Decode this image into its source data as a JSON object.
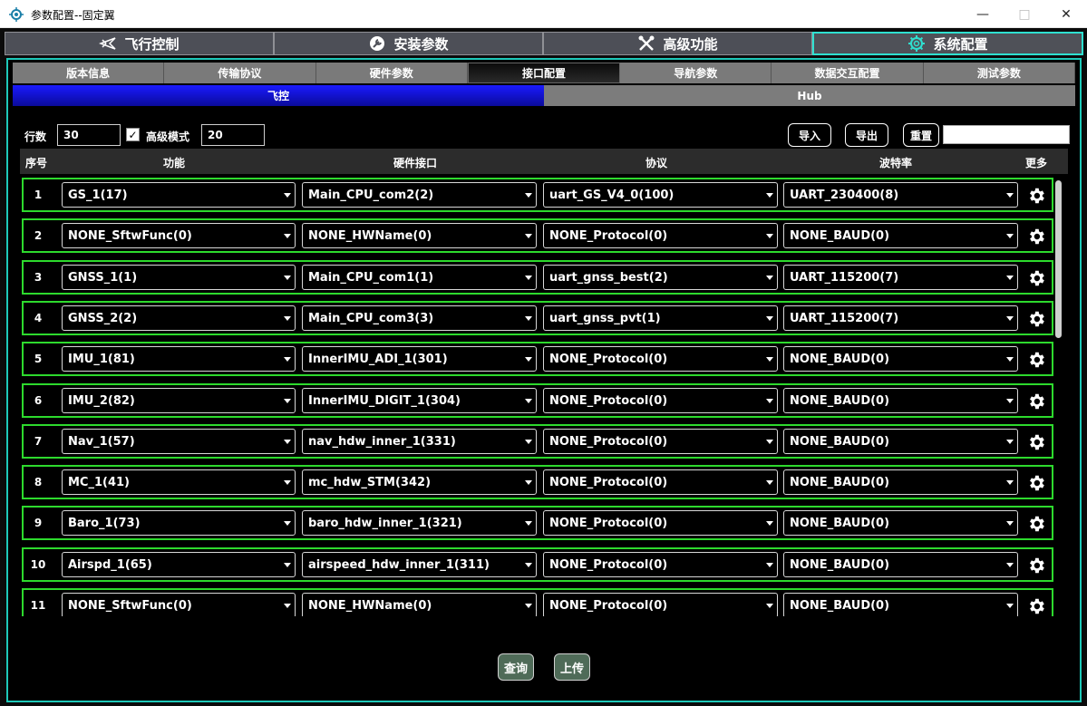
{
  "window": {
    "title": "参数配置--固定翼"
  },
  "main_tabs": [
    {
      "label": "飞行控制",
      "icon": "plane-icon"
    },
    {
      "label": "安装参数",
      "icon": "wrench-circle-icon"
    },
    {
      "label": "高级功能",
      "icon": "tools-icon"
    },
    {
      "label": "系统配置",
      "icon": "gear-icon"
    }
  ],
  "sub_tabs": [
    "版本信息",
    "传输协议",
    "硬件参数",
    "接口配置",
    "导航参数",
    "数据交互配置",
    "测试参数"
  ],
  "side_tabs": [
    "飞控",
    "Hub"
  ],
  "controls": {
    "rows_label": "行数",
    "rows_value": "30",
    "advanced_checked": "✓",
    "advanced_label": "高级模式",
    "advanced_value": "20",
    "import_label": "导入",
    "export_label": "导出",
    "reset_label": "重置",
    "search_value": ""
  },
  "table": {
    "headers": [
      "序号",
      "功能",
      "硬件接口",
      "协议",
      "波特率",
      "更多"
    ],
    "rows": [
      {
        "idx": "1",
        "func": "GS_1(17)",
        "hw": "Main_CPU_com2(2)",
        "proto": "uart_GS_V4_0(100)",
        "baud": "UART_230400(8)"
      },
      {
        "idx": "2",
        "func": "NONE_SftwFunc(0)",
        "hw": "NONE_HWName(0)",
        "proto": "NONE_Protocol(0)",
        "baud": "NONE_BAUD(0)"
      },
      {
        "idx": "3",
        "func": "GNSS_1(1)",
        "hw": "Main_CPU_com1(1)",
        "proto": "uart_gnss_best(2)",
        "baud": "UART_115200(7)"
      },
      {
        "idx": "4",
        "func": "GNSS_2(2)",
        "hw": "Main_CPU_com3(3)",
        "proto": "uart_gnss_pvt(1)",
        "baud": "UART_115200(7)"
      },
      {
        "idx": "5",
        "func": "IMU_1(81)",
        "hw": "InnerIMU_ADI_1(301)",
        "proto": "NONE_Protocol(0)",
        "baud": "NONE_BAUD(0)"
      },
      {
        "idx": "6",
        "func": "IMU_2(82)",
        "hw": "InnerIMU_DIGIT_1(304)",
        "proto": "NONE_Protocol(0)",
        "baud": "NONE_BAUD(0)"
      },
      {
        "idx": "7",
        "func": "Nav_1(57)",
        "hw": "nav_hdw_inner_1(331)",
        "proto": "NONE_Protocol(0)",
        "baud": "NONE_BAUD(0)"
      },
      {
        "idx": "8",
        "func": "MC_1(41)",
        "hw": "mc_hdw_STM(342)",
        "proto": "NONE_Protocol(0)",
        "baud": "NONE_BAUD(0)"
      },
      {
        "idx": "9",
        "func": "Baro_1(73)",
        "hw": "baro_hdw_inner_1(321)",
        "proto": "NONE_Protocol(0)",
        "baud": "NONE_BAUD(0)"
      },
      {
        "idx": "10",
        "func": "Airspd_1(65)",
        "hw": "airspeed_hdw_inner_1(311)",
        "proto": "NONE_Protocol(0)",
        "baud": "NONE_BAUD(0)"
      },
      {
        "idx": "11",
        "func": "NONE_SftwFunc(0)",
        "hw": "NONE_HWName(0)",
        "proto": "NONE_Protocol(0)",
        "baud": "NONE_BAUD(0)"
      }
    ]
  },
  "bottom": {
    "query_label": "查询",
    "upload_label": "上传"
  },
  "colors": {
    "accent": "#1ec9b9",
    "row_border": "#2dda2d",
    "side_active": "#1a1aff"
  }
}
